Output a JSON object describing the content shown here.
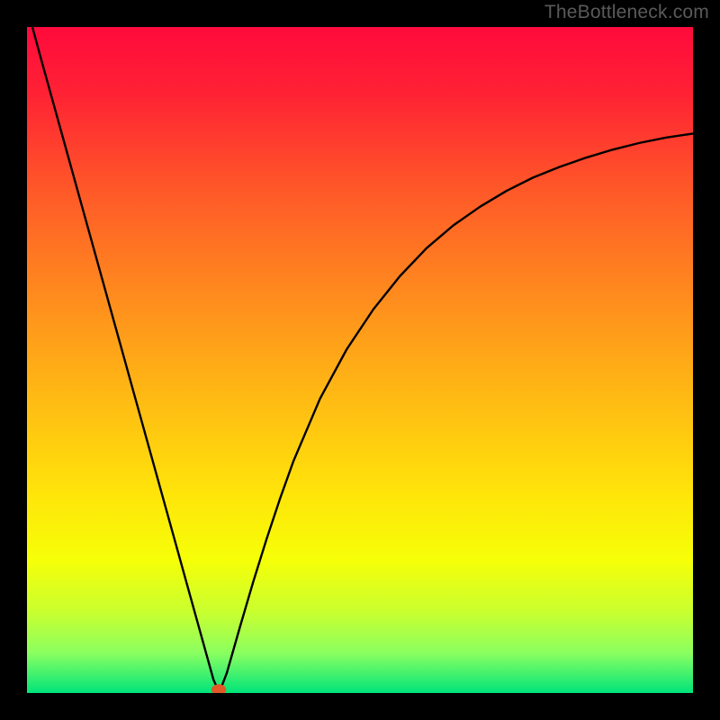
{
  "watermark": "TheBottleneck.com",
  "chart_data": {
    "type": "line",
    "title": "",
    "xlabel": "",
    "ylabel": "",
    "xlim": [
      0,
      100
    ],
    "ylim": [
      0,
      100
    ],
    "background_gradient": {
      "stops": [
        {
          "offset": 0.0,
          "color": "#ff0a3c"
        },
        {
          "offset": 0.1,
          "color": "#ff2234"
        },
        {
          "offset": 0.25,
          "color": "#ff5a28"
        },
        {
          "offset": 0.4,
          "color": "#ff8a1e"
        },
        {
          "offset": 0.55,
          "color": "#ffb814"
        },
        {
          "offset": 0.7,
          "color": "#ffe40a"
        },
        {
          "offset": 0.8,
          "color": "#f6ff08"
        },
        {
          "offset": 0.88,
          "color": "#c8ff30"
        },
        {
          "offset": 0.94,
          "color": "#8aff60"
        },
        {
          "offset": 1.0,
          "color": "#00e47a"
        }
      ]
    },
    "marker": {
      "x": 28.8,
      "y": 0.5,
      "color": "#e25826",
      "radius": 1.1
    },
    "series": [
      {
        "name": "bottleneck-curve",
        "color": "#000000",
        "x": [
          0,
          2,
          4,
          6,
          8,
          10,
          12,
          14,
          16,
          18,
          20,
          22,
          24,
          25,
          26,
          27,
          27.5,
          28,
          28.5,
          29,
          30,
          31,
          32,
          33,
          34,
          36,
          38,
          40,
          44,
          48,
          52,
          56,
          60,
          64,
          68,
          72,
          76,
          80,
          84,
          88,
          92,
          96,
          100
        ],
        "y": [
          103,
          95.6,
          88.4,
          81.2,
          74,
          66.8,
          59.6,
          52.4,
          45.2,
          38,
          30.8,
          23.6,
          16.4,
          12.8,
          9.2,
          5.6,
          3.8,
          2.0,
          0.9,
          0.4,
          3.0,
          6.5,
          10.0,
          13.4,
          16.8,
          23.2,
          29.2,
          34.8,
          44.2,
          51.6,
          57.6,
          62.6,
          66.8,
          70.2,
          73.0,
          75.4,
          77.4,
          79.0,
          80.4,
          81.6,
          82.6,
          83.4,
          84.0
        ]
      }
    ]
  },
  "colors": {
    "frame": "#000000",
    "curve": "#000000",
    "marker": "#e25826"
  }
}
